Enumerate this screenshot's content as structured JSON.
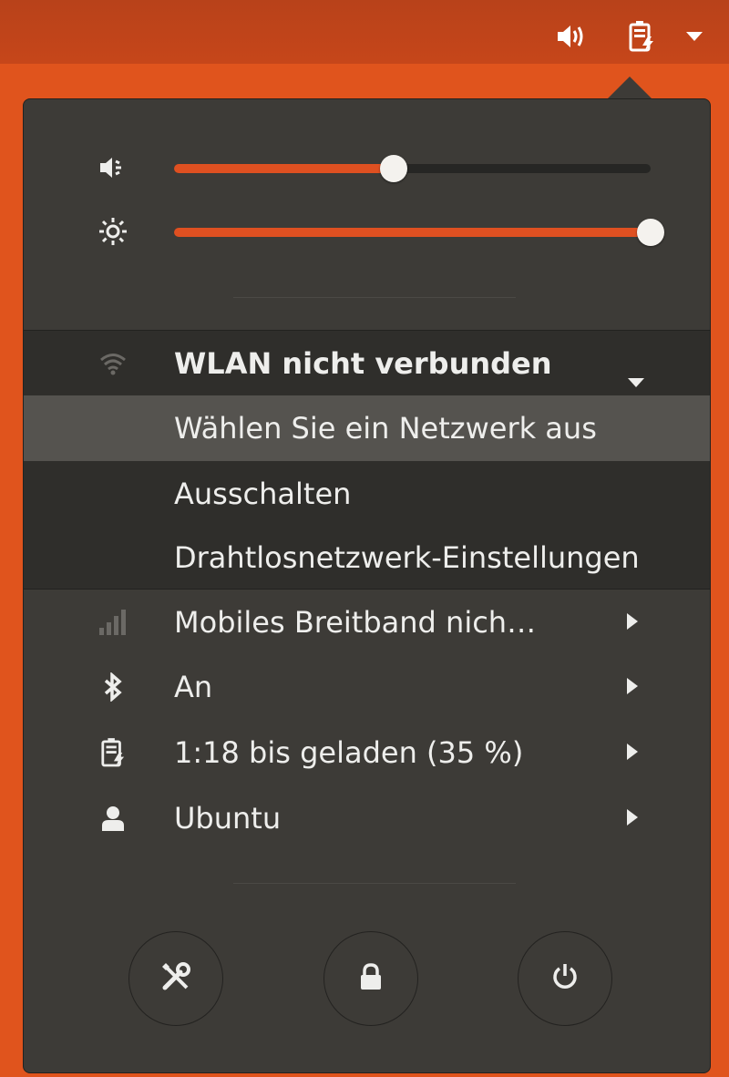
{
  "topbar": {
    "volume_icon": "audio-volume-high-icon",
    "battery_icon": "battery-charging-icon",
    "menu_arrow_icon": "dropdown-arrow-icon"
  },
  "sliders": {
    "volume": {
      "icon": "volume-low-icon",
      "level": 0.46
    },
    "brightness": {
      "icon": "brightness-icon",
      "level": 1.0
    }
  },
  "wifi": {
    "icon": "wifi-icon",
    "status": "WLAN nicht verbunden",
    "items": [
      "Wählen Sie ein Netzwerk aus",
      "Ausschalten",
      "Drahtlosnetzwerk-Einstellungen"
    ]
  },
  "rows": {
    "mobile": {
      "label": "Mobiles Breitband nich…",
      "icon": "cellular-signal-icon"
    },
    "bluetooth": {
      "label": "An",
      "icon": "bluetooth-icon"
    },
    "battery": {
      "label": "1:18 bis geladen (35 %)",
      "icon": "battery-charging-icon"
    },
    "user": {
      "label": "Ubuntu",
      "icon": "user-icon"
    }
  },
  "buttons": {
    "settings": "settings-tools-icon",
    "lock": "lock-icon",
    "power": "power-icon"
  },
  "colors": {
    "accent": "#df5021",
    "menu_bg": "#3d3b37",
    "topbar": "#c6461a"
  }
}
